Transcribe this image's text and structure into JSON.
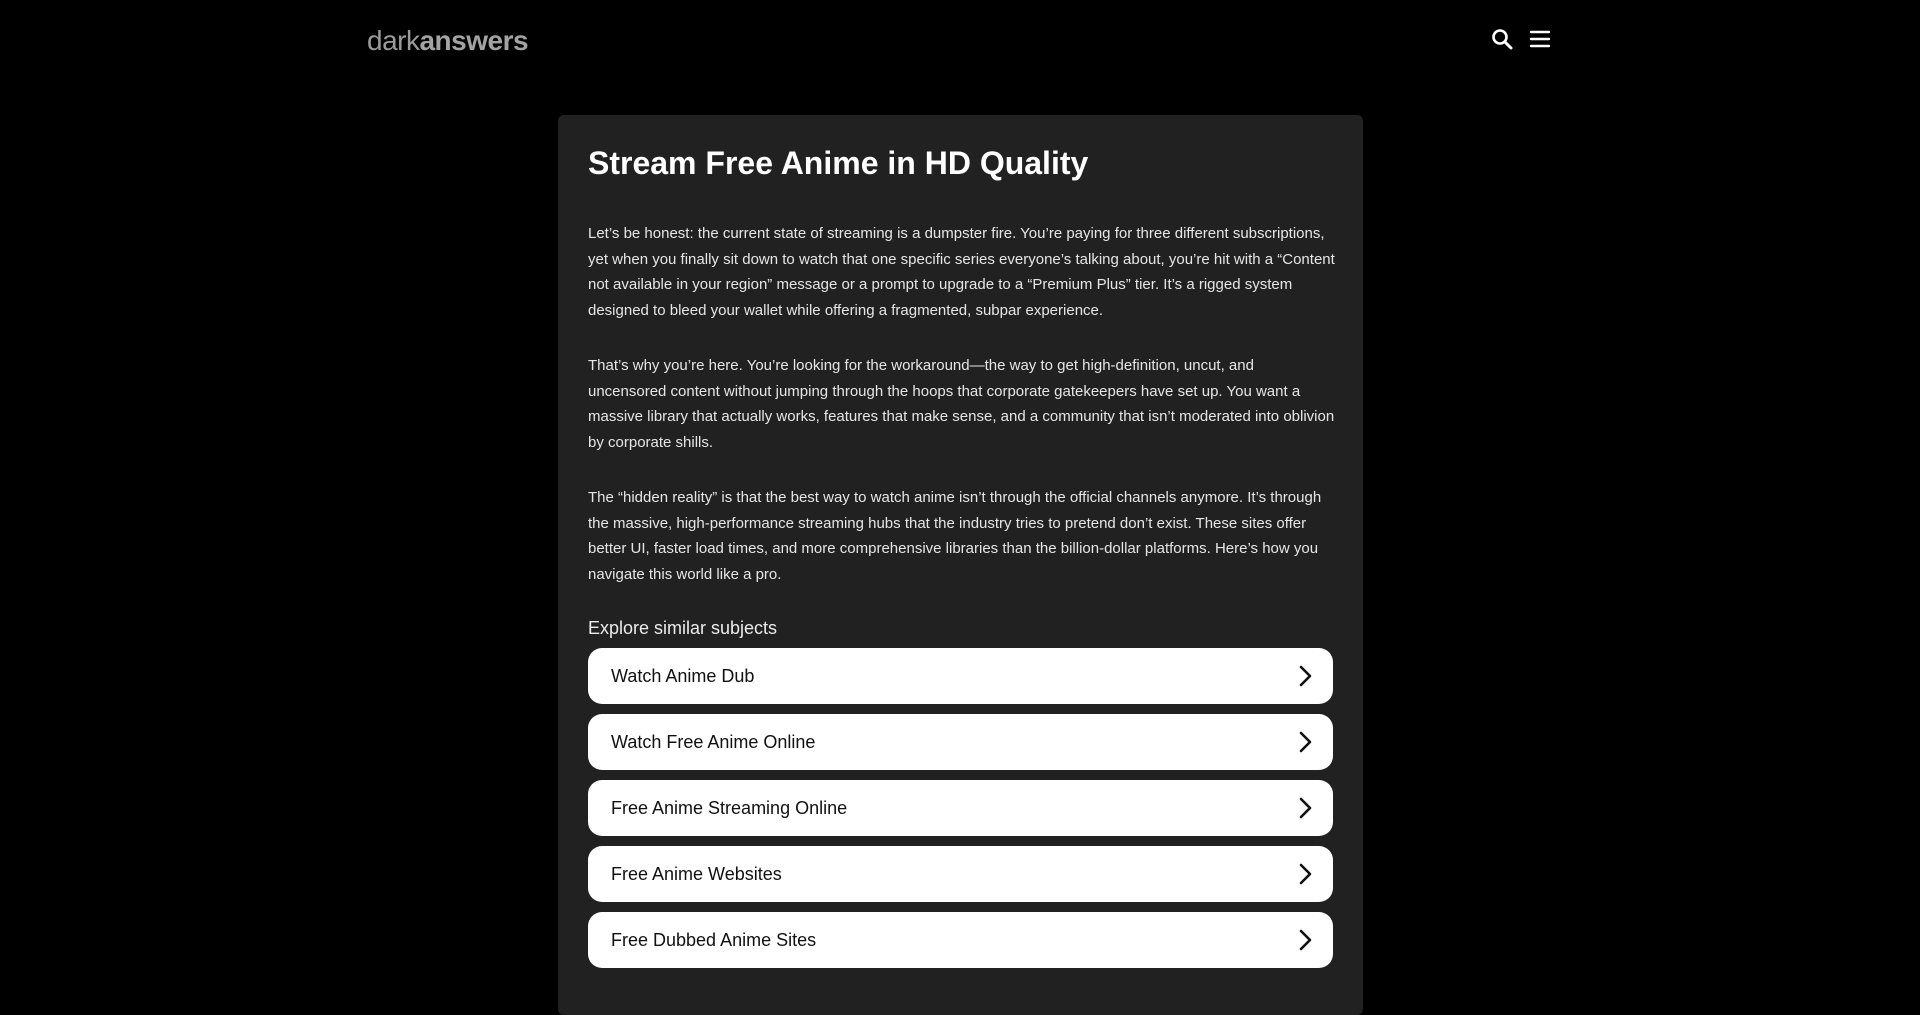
{
  "header": {
    "logo_light": "dark",
    "logo_bold": "answers",
    "icons": [
      "search-icon",
      "menu-icon"
    ]
  },
  "article": {
    "title": "Stream Free Anime in HD Quality",
    "paragraphs": [
      "Let’s be honest: the current state of streaming is a dumpster fire. You’re paying for three different subscriptions, yet when you finally sit down to watch that one specific series everyone’s talking about, you’re hit with a “Content not available in your region” message or a prompt to upgrade to a “Premium Plus” tier. It’s a rigged system designed to bleed your wallet while offering a fragmented, subpar experience.",
      "That’s why you’re here. You’re looking for the workaround—the way to get high-definition, uncut, and uncensored content without jumping through the hoops that corporate gatekeepers have set up. You want a massive library that actually works, features that make sense, and a community that isn’t moderated into oblivion by corporate shills.",
      "The “hidden reality” is that the best way to watch anime isn’t through the official channels anymore. It’s through the massive, high-performance streaming hubs that the industry tries to pretend don’t exist. These sites offer better UI, faster load times, and more comprehensive libraries than the billion-dollar platforms. Here’s how you navigate this world like a pro."
    ]
  },
  "explore": {
    "heading": "Explore similar subjects",
    "items": [
      {
        "label": "Watch Anime Dub"
      },
      {
        "label": "Watch Free Anime Online"
      },
      {
        "label": "Free Anime Streaming Online"
      },
      {
        "label": "Free Anime Websites"
      },
      {
        "label": "Free Dubbed Anime Sites"
      }
    ]
  },
  "colors": {
    "page_background": "#000000",
    "card_background": "#212121",
    "logo": "#9a9a9a",
    "link_background": "#ffffff"
  }
}
